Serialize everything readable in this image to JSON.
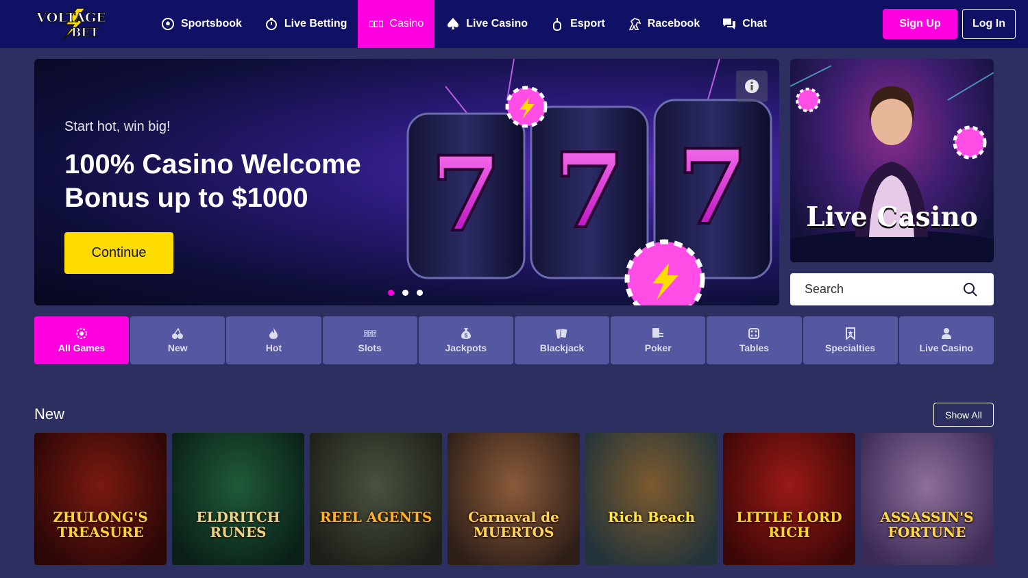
{
  "brand": {
    "logo_line1": "VOLTAGE",
    "logo_line2": "BET",
    "accent": "#ff00e1",
    "header_bg": "#101164",
    "cta_yellow": "#ffdc00"
  },
  "nav": [
    {
      "label": "Sportsbook",
      "icon": "soccer-ball-icon",
      "active": false
    },
    {
      "label": "Live Betting",
      "icon": "stopwatch-icon",
      "active": false
    },
    {
      "label": "Casino",
      "icon": "slot-777-icon",
      "active": true
    },
    {
      "label": "Live Casino",
      "icon": "spade-icon",
      "active": false
    },
    {
      "label": "Esport",
      "icon": "joystick-icon",
      "active": false
    },
    {
      "label": "Racebook",
      "icon": "horse-icon",
      "active": false
    },
    {
      "label": "Chat",
      "icon": "chat-icon",
      "active": false
    }
  ],
  "auth": {
    "signup": "Sign Up",
    "login": "Log In"
  },
  "banner": {
    "subtitle": "Start hot, win big!",
    "title": "100% Casino Welcome Bonus up to $1000",
    "cta": "Continue",
    "slides": 3,
    "active_slide": 1
  },
  "live_promo": {
    "title": "Live Casino"
  },
  "search": {
    "placeholder": "Search"
  },
  "categories": [
    {
      "label": "All Games",
      "icon": "all-games-icon",
      "active": true
    },
    {
      "label": "New",
      "icon": "cherries-icon",
      "active": false
    },
    {
      "label": "Hot",
      "icon": "flame-icon",
      "active": false
    },
    {
      "label": "Slots",
      "icon": "slots-777-icon",
      "active": false
    },
    {
      "label": "Jackpots",
      "icon": "money-bag-icon",
      "active": false
    },
    {
      "label": "Blackjack",
      "icon": "cards-icon",
      "active": false
    },
    {
      "label": "Poker",
      "icon": "poker-icon",
      "active": false
    },
    {
      "label": "Tables",
      "icon": "dice-icon",
      "active": false
    },
    {
      "label": "Specialties",
      "icon": "ribbon-icon",
      "active": false
    },
    {
      "label": "Live Casino",
      "icon": "dealer-icon",
      "active": false
    }
  ],
  "new_section": {
    "title": "New",
    "show_all": "Show All",
    "games": [
      {
        "name": "ZHULONG'S TREASURE",
        "bg1": "#7a1a10",
        "bg2": "#2a0606",
        "text": "#ffcf3a"
      },
      {
        "name": "ELDRITCH RUNES",
        "bg1": "#1f5a3a",
        "bg2": "#0a1f16",
        "text": "#e9d58a"
      },
      {
        "name": "REEL AGENTS",
        "bg1": "#4a5140",
        "bg2": "#1c1f18",
        "text": "#ffb12a"
      },
      {
        "name": "Carnaval de MUERTOS",
        "bg1": "#8a5a3a",
        "bg2": "#2d1e17",
        "text": "#ffd35a"
      },
      {
        "name": "Rich Beach",
        "bg1": "#7c5a2e",
        "bg2": "#22333a",
        "text": "#ffe54a"
      },
      {
        "name": "LITTLE LORD RICH",
        "bg1": "#9a1a16",
        "bg2": "#3c0707",
        "text": "#ffd12a"
      },
      {
        "name": "ASSASSIN'S FORTUNE",
        "bg1": "#8d6f9a",
        "bg2": "#3a2a55",
        "text": "#ffd84a"
      }
    ]
  }
}
